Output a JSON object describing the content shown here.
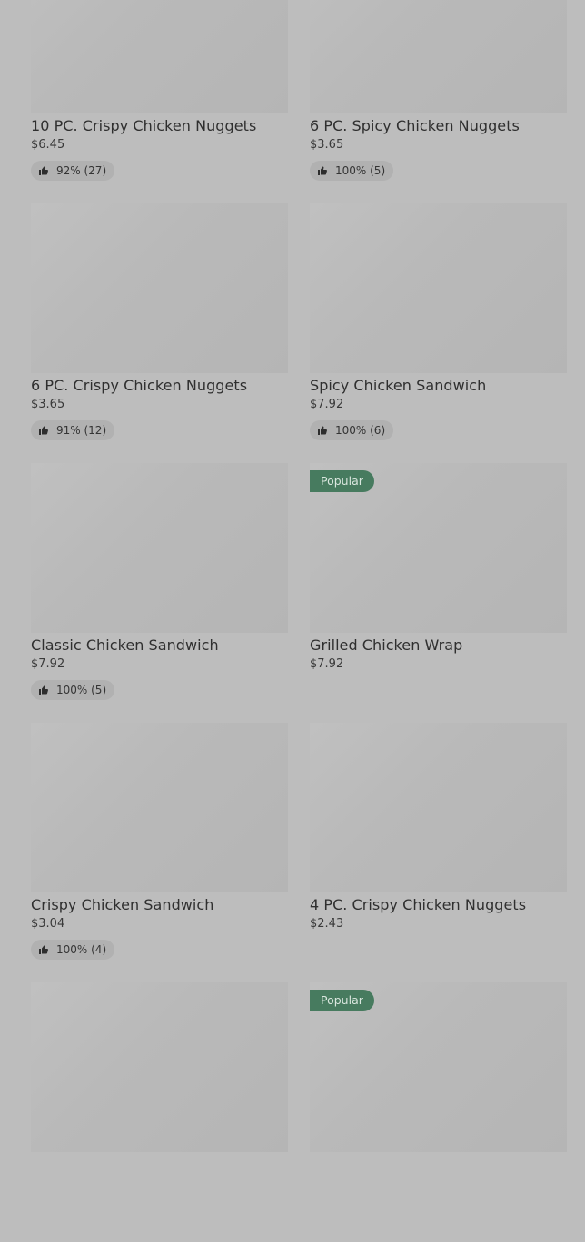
{
  "items": [
    {
      "name": "10 PC. Crispy Chicken Nuggets",
      "price": "$6.45",
      "rating": "92% (27)",
      "badge": ""
    },
    {
      "name": "6 PC. Spicy Chicken Nuggets",
      "price": "$3.65",
      "rating": "100% (5)",
      "badge": ""
    },
    {
      "name": "6 PC. Crispy Chicken Nuggets",
      "price": "$3.65",
      "rating": "91% (12)",
      "badge": ""
    },
    {
      "name": "Spicy Chicken Sandwich",
      "price": "$7.92",
      "rating": "100% (6)",
      "badge": ""
    },
    {
      "name": "Classic Chicken Sandwich",
      "price": "$7.92",
      "rating": "100% (5)",
      "badge": ""
    },
    {
      "name": "Grilled Chicken Wrap",
      "price": "$7.92",
      "rating": "",
      "badge": "Popular"
    },
    {
      "name": "Crispy Chicken Sandwich",
      "price": "$3.04",
      "rating": "100% (4)",
      "badge": ""
    },
    {
      "name": "4 PC. Crispy Chicken Nuggets",
      "price": "$2.43",
      "rating": "",
      "badge": ""
    },
    {
      "name": "",
      "price": "",
      "rating": "",
      "badge": ""
    },
    {
      "name": "",
      "price": "",
      "rating": "",
      "badge": "Popular"
    }
  ],
  "icons": {
    "rating_icon": "thumbs-up-icon"
  }
}
